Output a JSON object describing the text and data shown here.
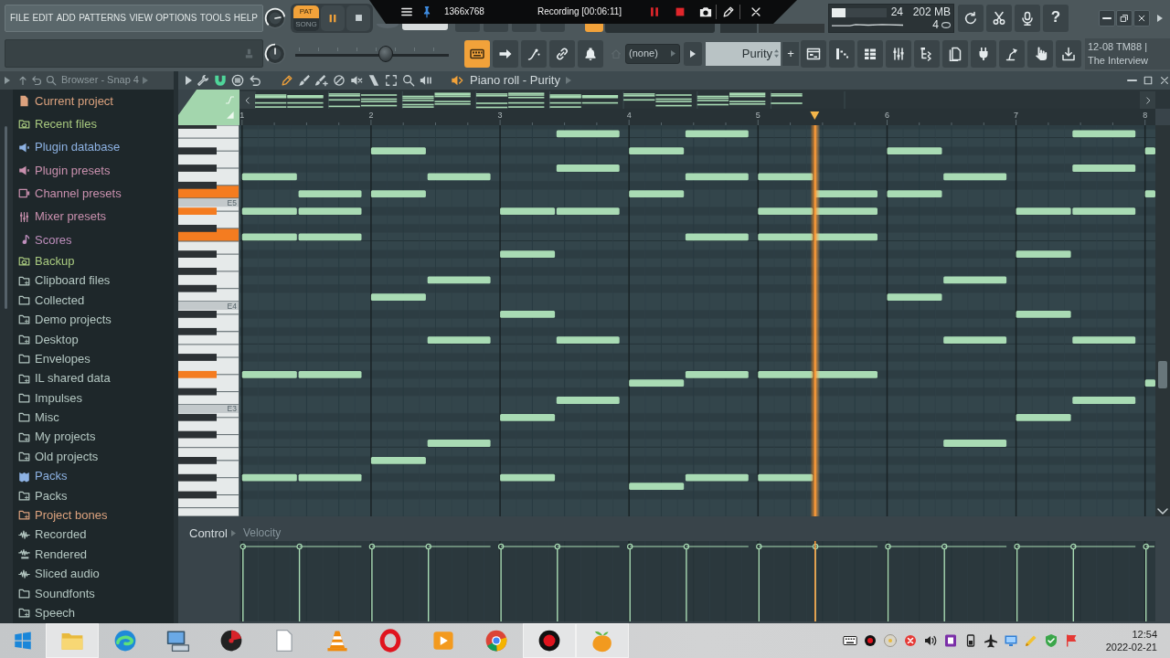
{
  "toolbar": {
    "menu": [
      "FILE",
      "EDIT",
      "ADD",
      "PATTERNS",
      "VIEW",
      "OPTIONS",
      "TOOLS",
      "HELP"
    ],
    "knobs": [
      {
        "level": 0.8
      },
      {
        "level": 0.5
      }
    ],
    "transport": {
      "modes": [
        {
          "label": "PAT",
          "selected": true
        },
        {
          "label": "SONG",
          "selected": false
        }
      ],
      "playing": true
    },
    "cpu": {
      "reading": "24",
      "level": 0.25
    },
    "memory": {
      "reading": "202 MB"
    },
    "polyphony": {
      "reading": "4"
    },
    "tool_buttons": [
      {
        "kind": "reload"
      },
      {
        "kind": "scissors"
      },
      {
        "kind": "microphone"
      },
      {
        "kind": "help",
        "label": "?"
      }
    ],
    "slider": {
      "level": 0.6
    },
    "mode_buttons": [
      {
        "kind": "keyboard",
        "on": true
      },
      {
        "kind": "arrow",
        "on": false
      },
      {
        "kind": "curve",
        "on": false
      },
      {
        "kind": "link",
        "on": false
      },
      {
        "kind": "bell",
        "on": false
      }
    ],
    "pattern": {
      "value": "(none)"
    },
    "channel": {
      "value": "Purity",
      "add_label": "+"
    },
    "window_buttons": [
      {
        "kind": "playlist"
      },
      {
        "kind": "piano-roll"
      },
      {
        "kind": "channel-rack"
      },
      {
        "kind": "mixer"
      },
      {
        "kind": "browser"
      },
      {
        "kind": "files"
      },
      {
        "kind": "plugin"
      },
      {
        "kind": "lamp"
      },
      {
        "kind": "touch"
      },
      {
        "kind": "download"
      }
    ],
    "news": [
      "12-08 TM88 |",
      "The Interview"
    ]
  },
  "recorder": {
    "size": "1366x768",
    "status": "Recording [00:06:11]"
  },
  "browser": {
    "title": "Browser - Snap 4",
    "pinned": [
      {
        "label": "Current project",
        "kind": "project",
        "color": "#dca27e"
      },
      {
        "label": "Recent files",
        "kind": "history",
        "color": "#a8c97f"
      },
      {
        "label": "Plugin database",
        "kind": "plugin-db",
        "color": "#8db2e3"
      },
      {
        "label": "Plugin presets",
        "kind": "plugin-presets",
        "color": "#c990ae"
      },
      {
        "label": "Channel presets",
        "kind": "channel",
        "color": "#c990ae"
      },
      {
        "label": "Mixer presets",
        "kind": "mixer",
        "color": "#c990ae"
      },
      {
        "label": "Scores",
        "kind": "score",
        "color": "#bf8fbd"
      }
    ],
    "folders": [
      {
        "label": "Backup",
        "kind": "history",
        "color": "#a8c97f"
      },
      {
        "label": "Clipboard files",
        "kind": "link-folder",
        "color": "#b4c7c2"
      },
      {
        "label": "Collected",
        "kind": "folder",
        "color": "#b4c7c2"
      },
      {
        "label": "Demo projects",
        "kind": "link-folder",
        "color": "#b4c7c2"
      },
      {
        "label": "Desktop",
        "kind": "link-folder",
        "color": "#b4c7c2"
      },
      {
        "label": "Envelopes",
        "kind": "folder",
        "color": "#b4c7c2"
      },
      {
        "label": "IL shared data",
        "kind": "link-folder",
        "color": "#b4c7c2"
      },
      {
        "label": "Impulses",
        "kind": "folder",
        "color": "#b4c7c2"
      },
      {
        "label": "Misc",
        "kind": "folder",
        "color": "#b4c7c2"
      },
      {
        "label": "My projects",
        "kind": "link-folder",
        "color": "#b4c7c2"
      },
      {
        "label": "Old projects",
        "kind": "link-folder",
        "color": "#b4c7c2"
      },
      {
        "label": "Packs",
        "kind": "pack",
        "color": "#8db2e3"
      },
      {
        "label": "Packs",
        "kind": "link-folder",
        "color": "#b4c7c2"
      },
      {
        "label": "Project bones",
        "kind": "link-folder",
        "color": "#dca27e"
      },
      {
        "label": "Recorded",
        "kind": "audio",
        "color": "#b4c7c2"
      },
      {
        "label": "Rendered",
        "kind": "render",
        "color": "#b4c7c2"
      },
      {
        "label": "Sliced audio",
        "kind": "audio",
        "color": "#b4c7c2"
      },
      {
        "label": "Soundfonts",
        "kind": "folder",
        "color": "#b4c7c2"
      },
      {
        "label": "Speech",
        "kind": "link-folder",
        "color": "#b4c7c2"
      }
    ]
  },
  "piano_roll": {
    "title": "Piano roll - Purity",
    "controls": [
      {
        "kind": "menu-arrow",
        "on": false
      },
      {
        "kind": "wrench",
        "on": false
      },
      {
        "kind": "magnet",
        "on": true
      },
      {
        "kind": "menu",
        "on": false
      },
      {
        "kind": "undo",
        "on": false
      }
    ],
    "tools": [
      {
        "kind": "pencil",
        "selected": true
      },
      {
        "kind": "brush",
        "selected": false
      },
      {
        "kind": "brush-plus",
        "selected": false
      },
      {
        "kind": "delete",
        "selected": false
      },
      {
        "kind": "mute",
        "selected": false
      },
      {
        "kind": "slice",
        "selected": false
      },
      {
        "kind": "select",
        "selected": false
      },
      {
        "kind": "zoom",
        "selected": false
      },
      {
        "kind": "playback",
        "selected": false
      }
    ],
    "bar_numbers": [
      "1",
      "2",
      "3",
      "4",
      "5",
      "6",
      "7",
      "8"
    ],
    "keyboard_labels": [
      "E5",
      "E4",
      "E3"
    ],
    "playhead": {
      "level": 0.628
    },
    "control_pane": {
      "label": "Control",
      "target": "Velocity"
    }
  },
  "taskbar": {
    "apps": [
      {
        "kind": "explorer",
        "active": true
      },
      {
        "kind": "swirl",
        "active": false
      },
      {
        "kind": "computer",
        "active": false
      },
      {
        "kind": "disc",
        "active": false
      },
      {
        "kind": "document",
        "active": false
      },
      {
        "kind": "cone",
        "active": false
      },
      {
        "kind": "ring",
        "active": false
      },
      {
        "kind": "player",
        "active": false
      },
      {
        "kind": "segmented",
        "active": false
      },
      {
        "kind": "recorder",
        "active": true
      },
      {
        "kind": "fruit",
        "active": true
      }
    ],
    "tray": [
      {
        "kind": "keyboard"
      },
      {
        "kind": "record"
      },
      {
        "kind": "cd"
      },
      {
        "kind": "blocked"
      },
      {
        "kind": "volume"
      },
      {
        "kind": "notebook"
      },
      {
        "kind": "battery"
      },
      {
        "kind": "airplane"
      },
      {
        "kind": "monitor"
      },
      {
        "kind": "pen"
      },
      {
        "kind": "shield"
      },
      {
        "kind": "flag"
      }
    ],
    "time": "12:54",
    "date": "2022-02-21"
  }
}
